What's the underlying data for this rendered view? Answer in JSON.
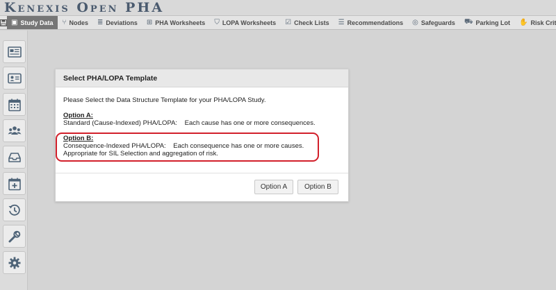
{
  "app": {
    "title": "Kenexis Open PHA"
  },
  "toolbar": {
    "save_icon": "save-icon",
    "tabs": [
      {
        "label": "Study Data",
        "icon": "id-card-icon",
        "active": true
      },
      {
        "label": "Nodes",
        "icon": "node-icon"
      },
      {
        "label": "Deviations",
        "icon": "list-icon"
      },
      {
        "label": "PHA Worksheets",
        "icon": "grid-icon"
      },
      {
        "label": "LOPA Worksheets",
        "icon": "shield-icon"
      },
      {
        "label": "Check Lists",
        "icon": "checkbox-icon"
      },
      {
        "label": "Recommendations",
        "icon": "bullet-list-icon"
      },
      {
        "label": "Safeguards",
        "icon": "life-ring-icon"
      },
      {
        "label": "Parking Lot",
        "icon": "car-icon"
      },
      {
        "label": "Risk Crit",
        "icon": "hand-icon"
      }
    ]
  },
  "sidebar": {
    "buttons": [
      "newspaper-icon",
      "id-card-icon",
      "calendar-icon",
      "users-icon",
      "inbox-icon",
      "calendar-plus-icon",
      "history-icon",
      "wrench-icon",
      "gear-icon"
    ]
  },
  "dialog": {
    "title": "Select PHA/LOPA Template",
    "intro": "Please Select the Data Structure Template for your PHA/LOPA Study.",
    "option_a": {
      "heading": "Option A:",
      "text": "Standard (Cause-Indexed) PHA/LOPA:    Each cause has one or more consequences."
    },
    "option_b": {
      "heading": "Option B:",
      "text": "Consequence-Indexed PHA/LOPA:    Each consequence has one or more causes.",
      "text2": "Appropriate for SIL Selection and aggregation of risk."
    },
    "button_a": "Option A",
    "button_b": "Option B"
  },
  "colors": {
    "highlight": "#d21f2a",
    "active_tab": "#767676"
  }
}
